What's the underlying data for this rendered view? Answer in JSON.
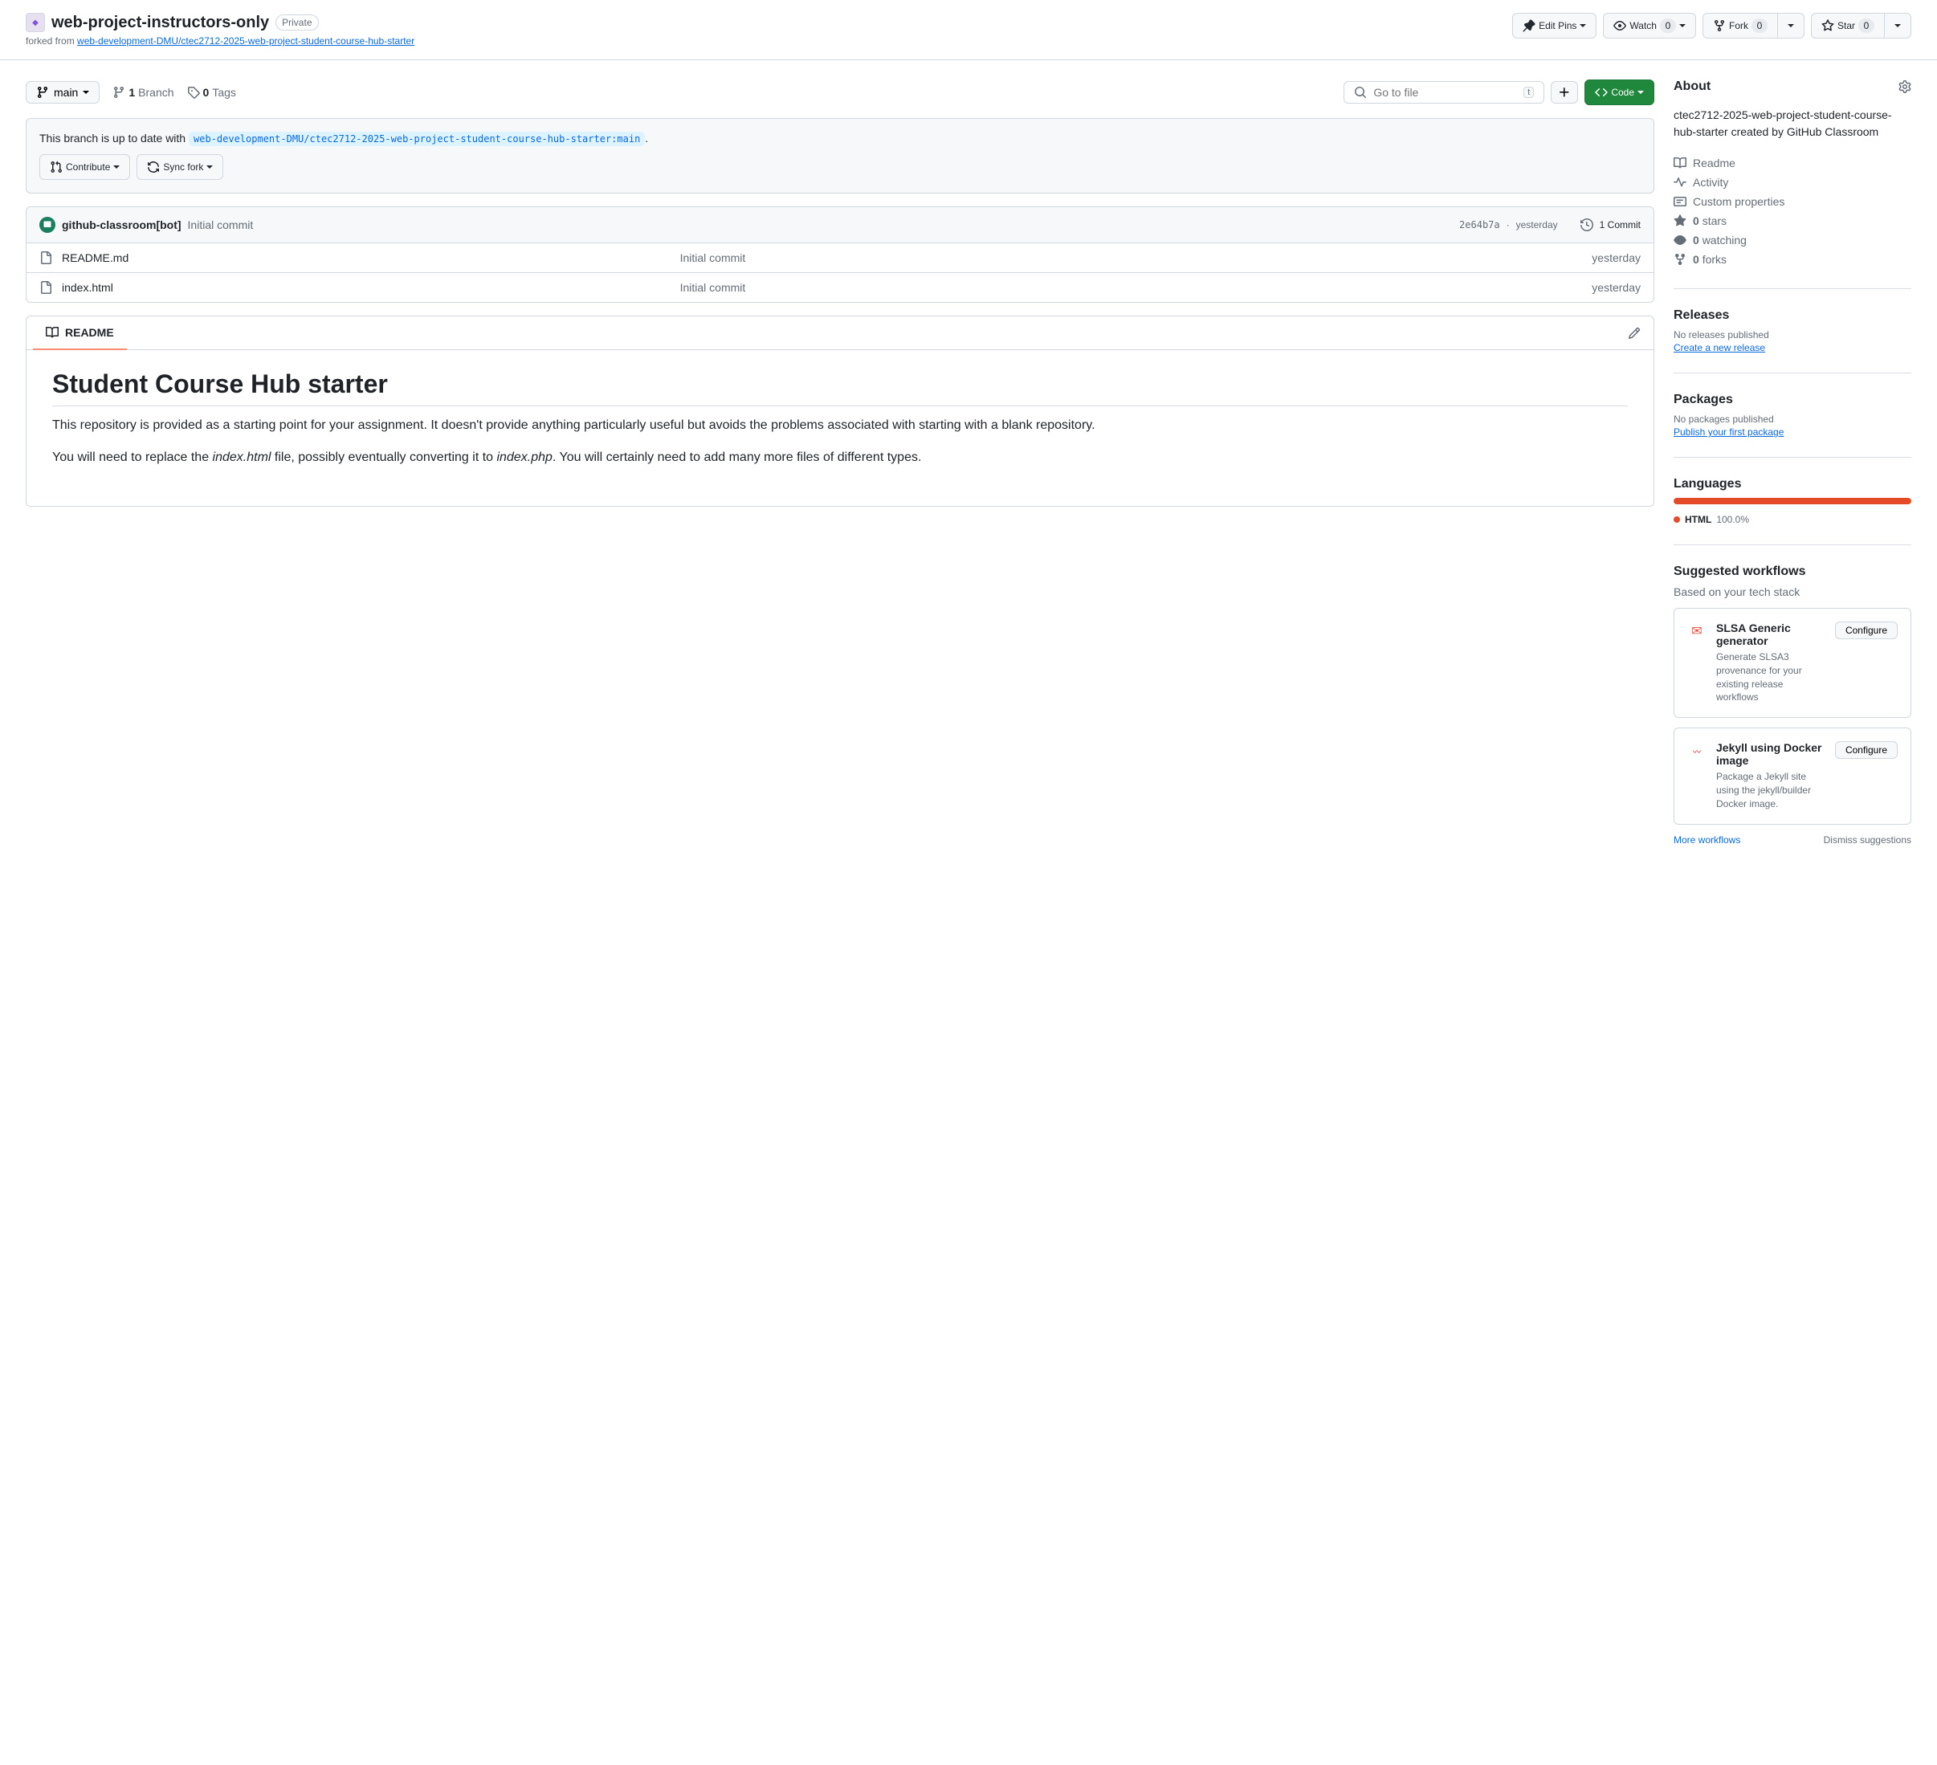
{
  "header": {
    "repo_name": "web-project-instructors-only",
    "visibility": "Private",
    "forked_label": "forked from ",
    "forked_link": "web-development-DMU/ctec2712-2025-web-project-student-course-hub-starter",
    "edit_pins": "Edit Pins",
    "watch": "Watch",
    "watch_count": "0",
    "fork": "Fork",
    "fork_count": "0",
    "star": "Star",
    "star_count": "0"
  },
  "nav": {
    "branch": "main",
    "branch_count": "1",
    "branch_label": "Branch",
    "tags_count": "0",
    "tags_label": "Tags",
    "search_placeholder": "Go to file",
    "search_kbd": "t",
    "code_btn": "Code"
  },
  "uptodate": {
    "prefix": "This branch is up to date with ",
    "ref": "web-development-DMU/ctec2712-2025-web-project-student-course-hub-starter:main",
    "suffix": ".",
    "contribute": "Contribute",
    "sync": "Sync fork"
  },
  "commit": {
    "author": "github-classroom[bot]",
    "message": "Initial commit",
    "sha": "2e64b7a",
    "date": "yesterday",
    "count": "1 Commit"
  },
  "files": [
    {
      "name": "README.md",
      "msg": "Initial commit",
      "date": "yesterday"
    },
    {
      "name": "index.html",
      "msg": "Initial commit",
      "date": "yesterday"
    }
  ],
  "readme": {
    "tab": "README",
    "h1": "Student Course Hub starter",
    "p1": "This repository is provided as a starting point for your assignment. It doesn't provide anything particularly useful but avoids the problems associated with starting with a blank repository.",
    "p2a": "You will need to replace the ",
    "p2_em1": "index.html",
    "p2b": " file, possibly eventually converting it to ",
    "p2_em2": "index.php",
    "p2c": ". You will certainly need to add many more files of different types."
  },
  "about": {
    "title": "About",
    "desc": "ctec2712-2025-web-project-student-course-hub-starter created by GitHub Classroom",
    "readme": "Readme",
    "activity": "Activity",
    "custom": "Custom properties",
    "stars_count": "0",
    "stars": "stars",
    "watching_count": "0",
    "watching": "watching",
    "forks_count": "0",
    "forks": "forks"
  },
  "releases": {
    "title": "Releases",
    "none": "No releases published",
    "create": "Create a new release"
  },
  "packages": {
    "title": "Packages",
    "none": "No packages published",
    "publish": "Publish your first package"
  },
  "languages": {
    "title": "Languages",
    "name": "HTML",
    "pct": "100.0%"
  },
  "workflows": {
    "title": "Suggested workflows",
    "subtitle": "Based on your tech stack",
    "items": [
      {
        "name": "SLSA Generic generator",
        "desc": "Generate SLSA3 provenance for your existing release workflows",
        "btn": "Configure"
      },
      {
        "name": "Jekyll using Docker image",
        "desc": "Package a Jekyll site using the jekyll/builder Docker image.",
        "btn": "Configure"
      }
    ],
    "more": "More workflows",
    "dismiss": "Dismiss suggestions"
  }
}
